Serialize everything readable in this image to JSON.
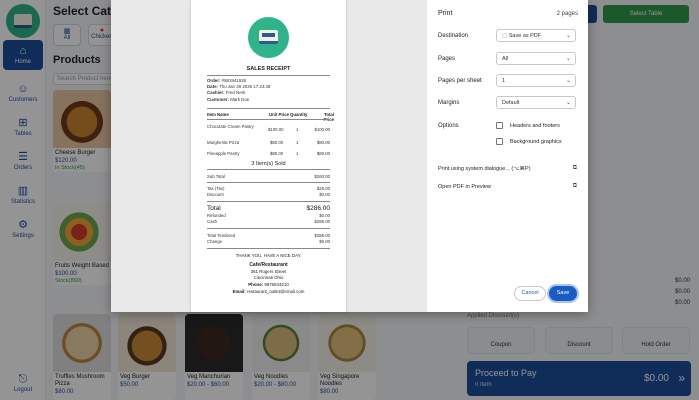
{
  "background_app": {
    "header_title": "Select Category",
    "categories": [
      {
        "label": "All",
        "icon": "grid-icon"
      },
      {
        "label": "Chicken",
        "icon": "chicken-icon"
      }
    ],
    "top_buttons": {
      "select_table": "Select Table"
    },
    "sidebar": [
      {
        "label": "Home",
        "icon": "home-icon"
      },
      {
        "label": "Customers",
        "icon": "users-icon"
      },
      {
        "label": "Tables",
        "icon": "table-icon"
      },
      {
        "label": "Orders",
        "icon": "orders-icon"
      },
      {
        "label": "Statistics",
        "icon": "stats-icon"
      },
      {
        "label": "Settings",
        "icon": "gear-icon"
      },
      {
        "label": "Logout",
        "icon": "logout-icon"
      }
    ],
    "products_title": "Products",
    "search_placeholder": "Search Product here",
    "products": [
      {
        "name": "Cheese Burger",
        "price": "$120.00",
        "stock": "In Stock(45)"
      },
      {
        "name": "Fruits Weight Based",
        "price": "$100.00",
        "stock": "Stock(890)"
      },
      {
        "name": "Truffles Mushroom Pizza",
        "price": "$80.00",
        "stock": ""
      },
      {
        "name": "Veg Burger",
        "price": "$50.00",
        "stock": ""
      },
      {
        "name": "Veg Manchurian",
        "price": "$20.00 - $60.00",
        "stock": ""
      },
      {
        "name": "Veg Noodles",
        "price": "$20.00 - $80.00",
        "stock": ""
      },
      {
        "name": "Veg Singapore Noodles",
        "price": "$80.00",
        "stock": ""
      }
    ],
    "summary_values": [
      "$0.00",
      "$0.00",
      "$0.00"
    ],
    "applied_label": "Applied Discount(s)",
    "actions": [
      "Coupon",
      "Discount",
      "Hold Order"
    ],
    "proceed": {
      "label": "Proceed to Pay",
      "items": "0 Item",
      "total": "$0.00",
      "chevrons": "»"
    }
  },
  "receipt": {
    "title": "SALES RECEIPT",
    "order_label": "Order:",
    "order_value": "#581941926",
    "date_label": "Date:",
    "date_value": "Thu Jan 29 2026 17:24:48",
    "cashier_label": "Cashier:",
    "cashier_value": "Fred Nerk",
    "customer_label": "Customer:",
    "customer_value": "Mark Doe",
    "columns": [
      "Item Name",
      "Unit Price",
      "Quantity",
      "Total Price"
    ],
    "items": [
      {
        "name": "Chocolate Cream Pastry",
        "unit": "$100.00",
        "qty": "1",
        "total": "$100.00"
      },
      {
        "name": "Margherita Pizza",
        "unit": "$80.00",
        "qty": "1",
        "total": "$80.00"
      },
      {
        "name": "Pineapple Pastry",
        "unit": "$80.00",
        "qty": "1",
        "total": "$80.00"
      }
    ],
    "items_sold": "3 Item(s) Sold",
    "subtotal_label": "Sub Total",
    "subtotal_value": "$260.00",
    "tax_label": "Tax (Tax)",
    "tax_value": "$26.00",
    "discount_label": "Discount",
    "discount_value": "$0.00",
    "total_label": "Total",
    "total_value": "$286.00",
    "refunded_label": "Refunded",
    "refunded_value": "$0.00",
    "cash_label": "Cash",
    "cash_value": "$286.00",
    "tendered_label": "Total Tendered",
    "tendered_value": "$286.00",
    "change_label": "Change",
    "change_value": "$0.00",
    "thanks": "THANK YOU, HAVE A NICE DAY.",
    "store_name": "Cafe/Restaurant",
    "store_address1": "361 Rogers Street",
    "store_address2": "Cincinnati Ohio",
    "phone_label": "Phone:",
    "phone_value": "9876543210",
    "email_label": "Email:",
    "email_value": "restaurant_outlet@email.com"
  },
  "print": {
    "title": "Print",
    "page_count": "2 pages",
    "destination_label": "Destination",
    "destination_value": "Save as PDF",
    "pages_label": "Pages",
    "pages_value": "All",
    "pps_label": "Pages per sheet",
    "pps_value": "1",
    "margins_label": "Margins",
    "margins_value": "Default",
    "options_label": "Options",
    "opt_headers": "Headers and footers",
    "opt_background": "Background graphics",
    "system_dialog": "Print using system dialogue... (⌥⌘P)",
    "open_pdf": "Open PDF in Preview",
    "cancel": "Cancel",
    "save": "Save"
  }
}
